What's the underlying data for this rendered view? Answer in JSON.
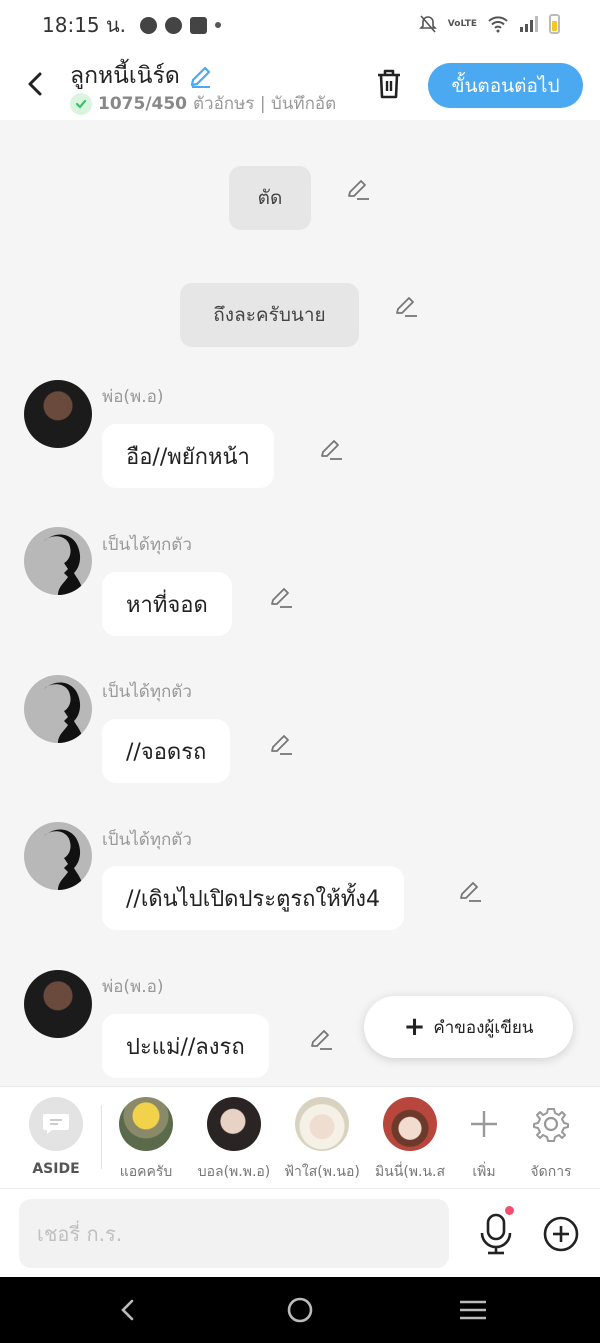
{
  "status_bar": {
    "time": "18:15 น.",
    "network_label": "VoLTE"
  },
  "header": {
    "title": "ลูกหนี้เนิร์ด",
    "char_count": "1075/450",
    "char_suffix": "ตัวอักษร | บันทึกอัต",
    "next_label": "ขั้นตอนต่อไป"
  },
  "narrations": [
    {
      "text": "ตัด"
    },
    {
      "text": "ถึงละครับนาย"
    }
  ],
  "messages": [
    {
      "speaker": "พ่อ(พ.อ)",
      "text": "อือ//พยักหน้า",
      "avatar": "dark"
    },
    {
      "speaker": "เป็นได้ทุกตัว",
      "text": "หาที่จอด",
      "avatar": "silhouette"
    },
    {
      "speaker": "เป็นได้ทุกตัว",
      "text": "//จอดรถ",
      "avatar": "silhouette"
    },
    {
      "speaker": "เป็นได้ทุกตัว",
      "text": "//เดินไปเปิดประตูรถให้ทั้ง4",
      "avatar": "silhouette"
    },
    {
      "speaker": "พ่อ(พ.อ)",
      "text": "ปะแม่//ลงรถ",
      "avatar": "dark"
    }
  ],
  "writer_note": {
    "label": "คำของผู้เขียน"
  },
  "characters": [
    {
      "label": "ASIDE"
    },
    {
      "label": "แอคครับ"
    },
    {
      "label": "บอล(พ.พ.อ)"
    },
    {
      "label": "ฟ้าใส(พ.นอ)"
    },
    {
      "label": "มินนี่(พ.น.ส"
    },
    {
      "label": "เพิ่ม"
    },
    {
      "label": "จัดการ"
    }
  ],
  "input": {
    "placeholder": "เชอรี่ ก.ร."
  },
  "colors": {
    "accent": "#4aa9f0",
    "check_green": "#3cc06a",
    "notify_dot": "#f0506e"
  }
}
